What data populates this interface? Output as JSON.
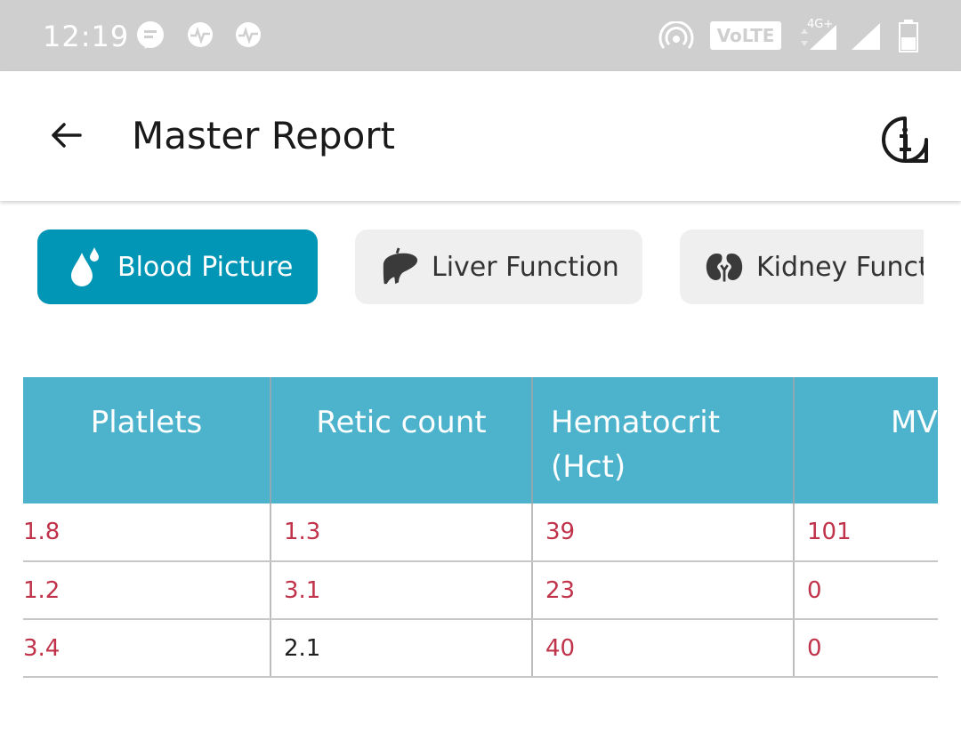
{
  "status_bar": {
    "time": "12:19",
    "volte": "VoLTE",
    "network": "4G+"
  },
  "app_bar": {
    "title": "Master Report",
    "back_icon": "arrow-left-icon",
    "info_icon": "info-icon"
  },
  "tabs": [
    {
      "label": "Blood Picture",
      "icon": "blood-drop-icon",
      "active": true
    },
    {
      "label": "Liver Function",
      "icon": "liver-icon",
      "active": false
    },
    {
      "label": "Kidney Function",
      "icon": "kidney-icon",
      "active": false
    }
  ],
  "table": {
    "headers": [
      "Platlets",
      "Retic count",
      "Hematocrit (Hct)",
      "MV"
    ],
    "rows": [
      [
        "1.8",
        "1.3",
        "39",
        "101"
      ],
      [
        "1.2",
        "3.1",
        "23",
        "0"
      ],
      [
        "3.4",
        "2.1",
        "40",
        "0"
      ]
    ]
  },
  "colors": {
    "primary": "#0196b5",
    "header": "#4db3cc",
    "value_red": "#c0334a",
    "status_bar": "#cfcfcf"
  }
}
